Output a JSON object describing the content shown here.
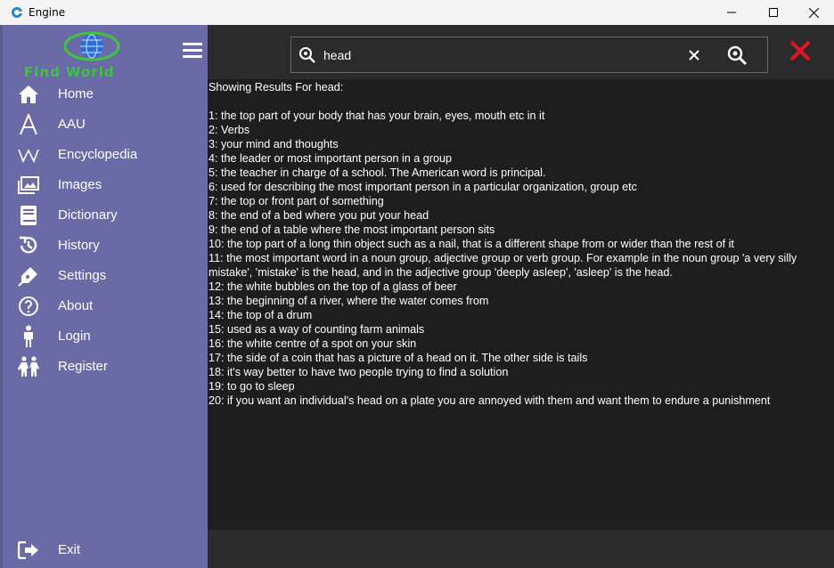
{
  "window": {
    "title": "Engine"
  },
  "logo": {
    "text": "Find World"
  },
  "nav": {
    "items": [
      {
        "label": "Home",
        "icon": "home-icon"
      },
      {
        "label": "AAU",
        "icon": "letter-a-icon"
      },
      {
        "label": "Encyclopedia",
        "icon": "wikipedia-icon"
      },
      {
        "label": "Images",
        "icon": "images-icon"
      },
      {
        "label": "Dictionary",
        "icon": "book-icon"
      },
      {
        "label": "History",
        "icon": "history-icon"
      },
      {
        "label": "Settings",
        "icon": "pen-icon"
      },
      {
        "label": "About",
        "icon": "question-icon"
      },
      {
        "label": "Login",
        "icon": "person-icon"
      },
      {
        "label": "Register",
        "icon": "people-icon"
      }
    ],
    "exit_label": "Exit"
  },
  "search": {
    "value": "head"
  },
  "results": {
    "header": "Showing Results For head:",
    "lines": [
      "1: the top part of your body that has your brain, eyes, mouth etc in it",
      "2: Verbs",
      "3: your mind and thoughts",
      "4: the leader or most important person in a group",
      "5: the teacher in charge of a school. The American word is principal.",
      "6: used for describing the most important person in a particular organization, group etc",
      "7: the top or front part of something",
      "8: the end of a bed where you put your head",
      "9: the end of a table where the most important person sits",
      "10: the top part of a long thin object such as a nail, that is a different shape from or wider than the rest of it",
      "11: the most important word in a noun group, adjective group or verb group. For example in the noun group 'a very silly mistake', 'mistake' is the head, and in the adjective group 'deeply asleep', 'asleep' is the head.",
      "12: the white bubbles on the top of a glass of beer",
      "13: the beginning of a river, where the water comes from",
      "14: the top of a drum",
      "15: used as a way of counting farm animals",
      "16: the white centre of a spot on your skin",
      "17: the side of a coin that has a picture of a head on it. The other side is tails",
      "18: it's way better to have two people trying to find a solution",
      "19: to go to sleep",
      "20: if you want an individual's head on a plate you are annoyed with them and want them to endure a punishment"
    ]
  },
  "colors": {
    "sidebar": "#6a6aa6",
    "main_bg": "#1e1e1e",
    "close_red": "#e81123",
    "logo_green": "#3fc43f"
  }
}
